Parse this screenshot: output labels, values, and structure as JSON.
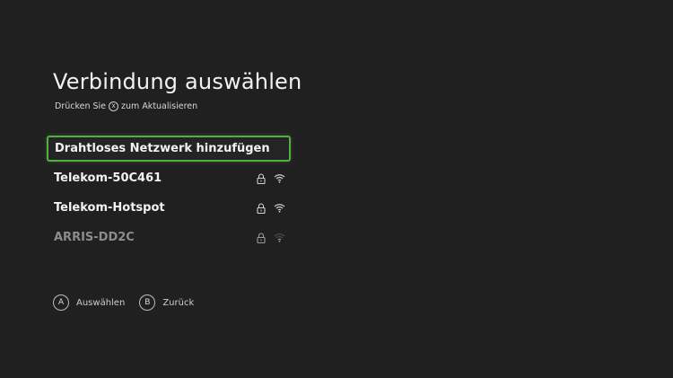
{
  "page": {
    "title": "Verbindung auswählen",
    "subtitle_before": "Drücken Sie",
    "subtitle_button": "X",
    "subtitle_after": "zum Aktualisieren"
  },
  "networks": [
    {
      "label": "Drahtloses Netzwerk hinzufügen",
      "selected": true,
      "locked": false,
      "signal": "none"
    },
    {
      "label": "Telekom-50C461",
      "selected": false,
      "locked": true,
      "signal": "strong",
      "icons": [
        "lock-icon",
        "wifi-icon"
      ]
    },
    {
      "label": "Telekom-Hotspot",
      "selected": false,
      "locked": true,
      "signal": "strong",
      "icons": [
        "lock-icon",
        "wifi-icon"
      ]
    },
    {
      "label": "ARRIS-DD2C",
      "selected": false,
      "locked": true,
      "signal": "weak",
      "icons": [
        "lock-icon",
        "wifi-icon"
      ]
    }
  ],
  "footer": {
    "select_button": "A",
    "select_label": "Auswählen",
    "back_button": "B",
    "back_label": "Zurück"
  },
  "colors": {
    "background": "#202020",
    "accent": "#52b043",
    "text": "#f2f2f2",
    "dim_text": "#8c8c8c"
  }
}
